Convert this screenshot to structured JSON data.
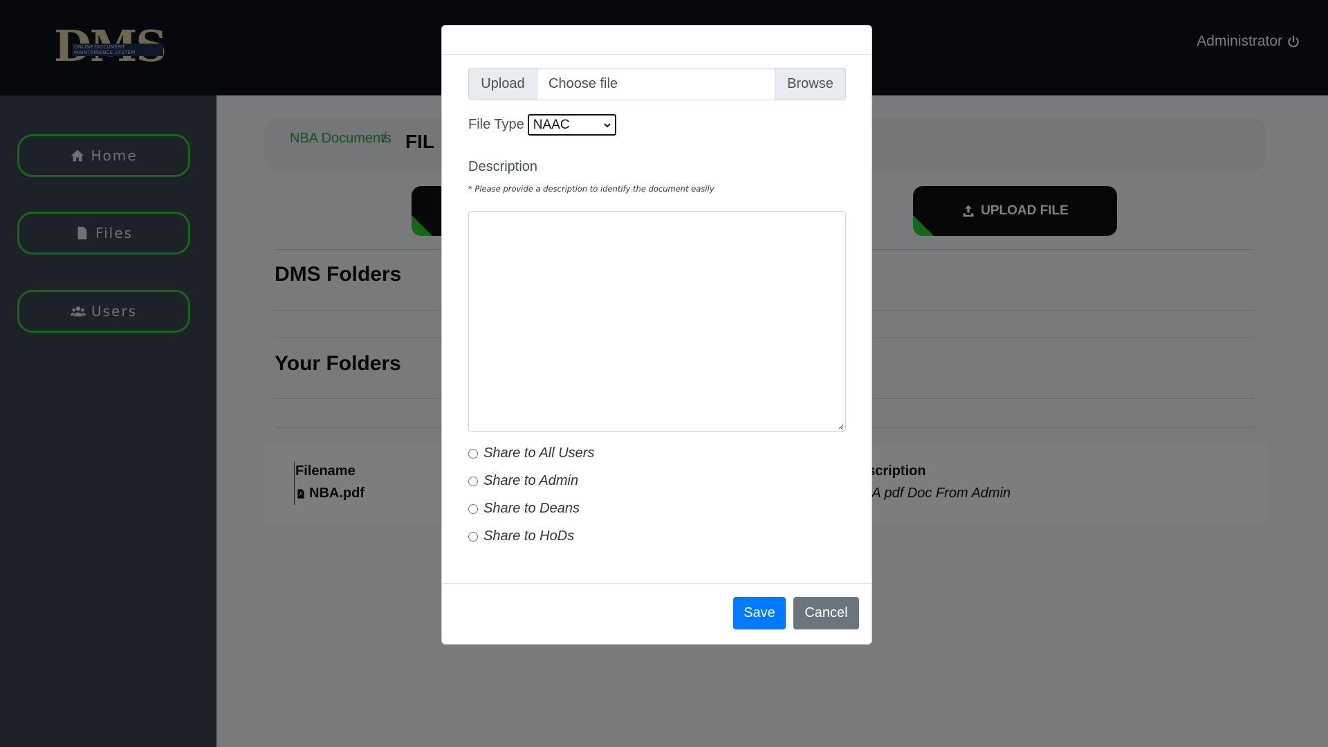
{
  "header": {
    "logo_text": "DMS",
    "logo_subtitle": "ONLINE DOCUMENT MAINTAINENCE SYSTEM",
    "user_label": "Administrator"
  },
  "sidebar": {
    "items": [
      {
        "label": "Home",
        "icon": "home-icon"
      },
      {
        "label": "Files",
        "icon": "file-icon"
      },
      {
        "label": "Users",
        "icon": "users-icon"
      }
    ]
  },
  "main": {
    "breadcrumb_link": "NBA Documents",
    "breadcrumb_separator": "/",
    "breadcrumb_current": "FIL",
    "upload_button": "UPLOAD FILE",
    "dms_folders_title": "DMS Folders",
    "your_folders_title": "Your Folders",
    "table": {
      "headers": [
        "Filename",
        "escription"
      ],
      "rows": [
        {
          "filename": "NBA.pdf",
          "description": "BA pdf Doc From Admin"
        }
      ]
    }
  },
  "modal": {
    "upload_addon": "Upload",
    "file_placeholder": "Choose file",
    "browse_label": "Browse",
    "file_type_label": "File Type",
    "file_type_value": "NAAC",
    "description_label": "Description",
    "description_hint": "* Please provide a description to identify the document easily",
    "share_options": [
      "Share to All Users",
      "Share to Admin",
      "Share to Deans",
      "Share to HoDs"
    ],
    "save_label": "Save",
    "cancel_label": "Cancel"
  },
  "colors": {
    "accent_green": "#2bd12b",
    "primary_blue": "#007bff",
    "secondary_gray": "#6c757d",
    "topbar": "#0d1117",
    "sidebar": "#3a4250"
  }
}
